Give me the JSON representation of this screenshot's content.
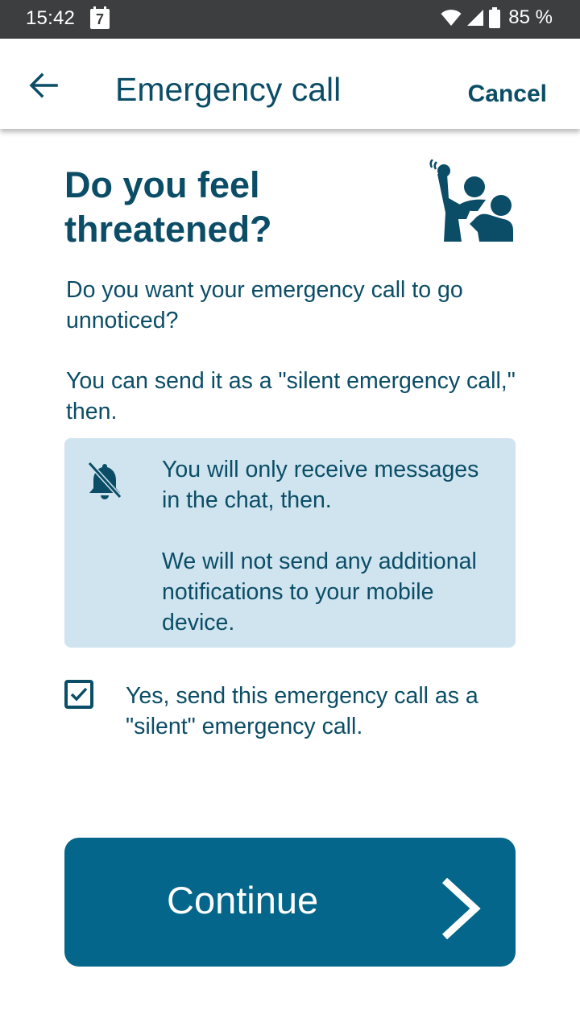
{
  "status_bar": {
    "time": "15:42",
    "calendar_day": "7",
    "battery_text": "85 %",
    "icons": [
      "wifi-icon",
      "cell-signal-icon",
      "battery-icon"
    ]
  },
  "app_bar": {
    "back_icon": "arrow-left-icon",
    "title": "Emergency call",
    "cancel_label": "Cancel"
  },
  "content": {
    "heading": "Do you feel threatened?",
    "illustration": "threatened-people-icon",
    "paragraph1": "Do you want your emergency call to go unnoticed?",
    "paragraph2": "You can send it as a \"silent emergency call,\" then.",
    "info_box": {
      "icon": "bell-off-icon",
      "text1": "You will only receive messages in the chat, then.",
      "text2": "We will not send any additional notifications to your mobile device."
    },
    "checkbox": {
      "checked": true,
      "label": "Yes, send this emergency call as a \"silent\" emergency call."
    }
  },
  "footer": {
    "continue_label": "Continue",
    "continue_icon": "chevron-right-icon"
  },
  "colors": {
    "primary_text": "#0b4d66",
    "button_bg": "#03668a",
    "info_bg": "#cfe4ef",
    "status_bar_bg": "#3d3e40"
  }
}
